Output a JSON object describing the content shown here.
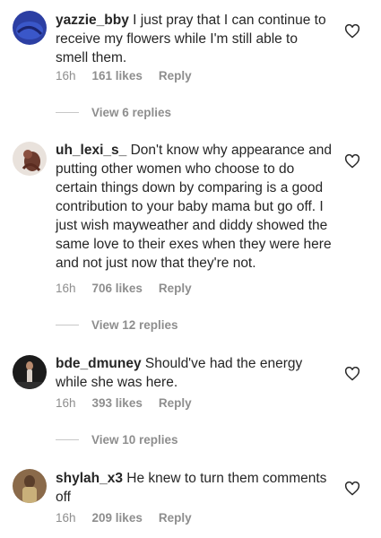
{
  "comments": [
    {
      "username": "yazzie_bby",
      "text": "I just pray that I can continue to receive my flowers while I'm still able to smell them.",
      "time": "16h",
      "likes": "161 likes",
      "reply": "Reply",
      "replies": "View 6 replies"
    },
    {
      "username": "uh_lexi_s_",
      "text": "Don't know why appearance and putting other women who choose to do certain things down by comparing is a good contribution to your baby mama but go off.  I just wish mayweather and diddy showed the same love to their exes when they were here and not just now that they're not.",
      "time": "16h",
      "likes": "706 likes",
      "reply": "Reply",
      "replies": "View 12 replies"
    },
    {
      "username": "bde_dmuney",
      "text": "Should've had the energy while she was here.",
      "time": "16h",
      "likes": "393 likes",
      "reply": "Reply",
      "replies": "View 10 replies"
    },
    {
      "username": "shylah_x3",
      "text": "He knew to turn them comments off",
      "time": "16h",
      "likes": "209 likes",
      "reply": "Reply"
    }
  ]
}
